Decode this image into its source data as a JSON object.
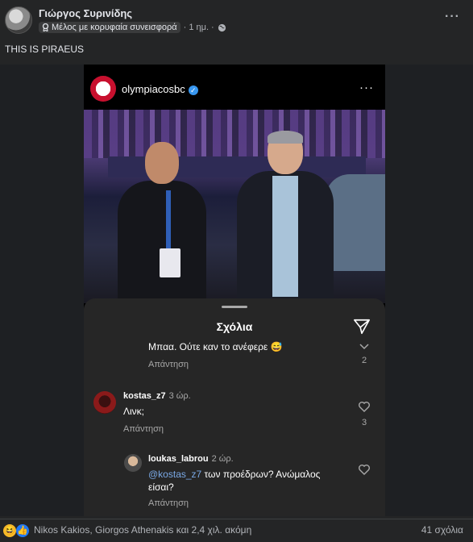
{
  "post": {
    "author": "Γιώργος Συρινίδης",
    "badge": "Μέλος με κορυφαία συνεισφορά",
    "time": "· 1 ημ. ·",
    "text": "THIS IS PIRAEUS"
  },
  "instagram": {
    "username": "olympiacosbc",
    "sheet_title": "Σχόλια",
    "comments": [
      {
        "text": "Μπαα. Ούτε καν το ανέφερε 😅",
        "reply_label": "Απάντηση",
        "likes": "2"
      },
      {
        "user": "kostas_z7",
        "time": "3 ώρ.",
        "text": "Λινκ;",
        "reply_label": "Απάντηση",
        "likes": "3"
      },
      {
        "user": "loukas_labrou",
        "time": "2 ώρ.",
        "mention": "@kostas_z7",
        "text_line1": " των προέδρων? Ανώμαλος",
        "text_line2": "είσαι?",
        "reply_label": "Απάντηση"
      }
    ]
  },
  "footer": {
    "reactions": [
      "😆",
      "👍"
    ],
    "names": "Nikos Kakios, Giorgos Athenakis και 2,4 χιλ. ακόμη",
    "comments_count": "41 σχόλια"
  }
}
